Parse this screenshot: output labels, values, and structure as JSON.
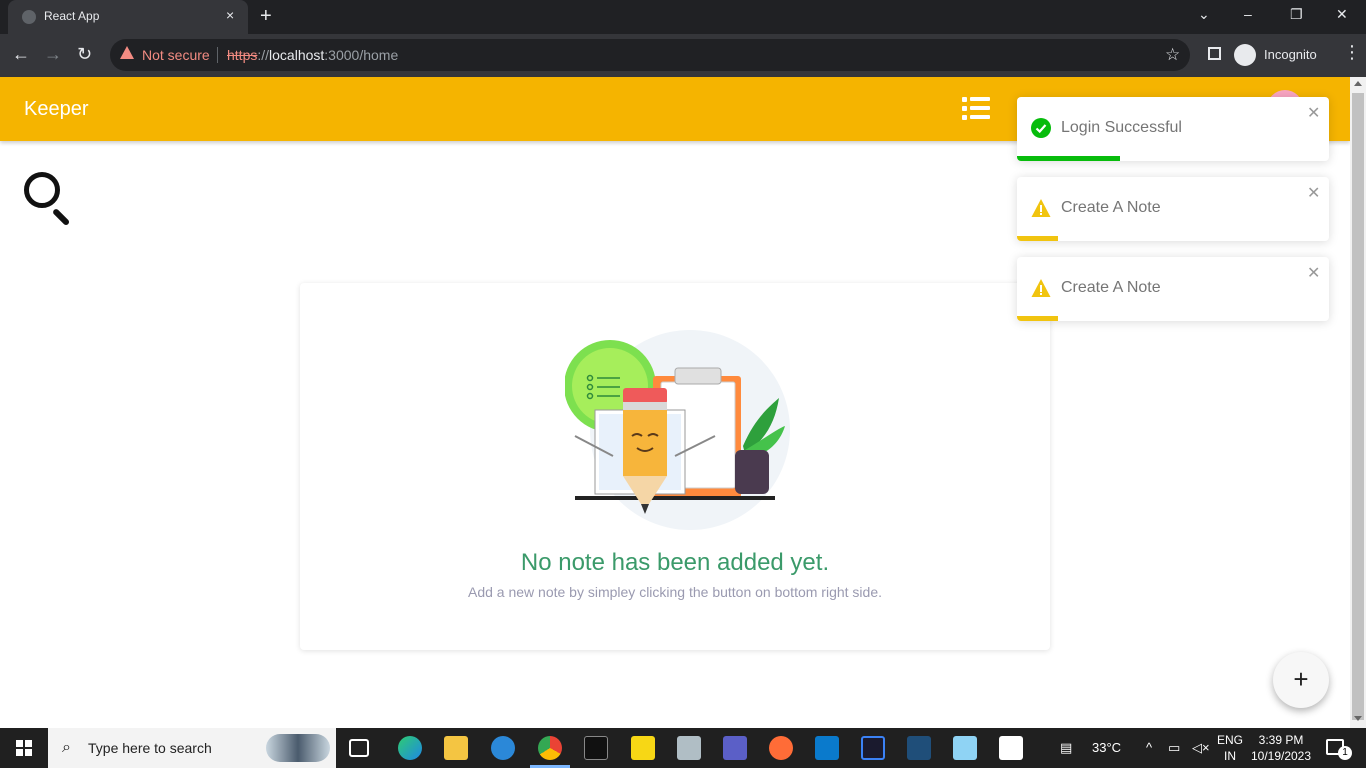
{
  "browser": {
    "tab_title": "React App",
    "tab_close": "×",
    "new_tab": "+",
    "security_label": "Not secure",
    "url_scheme": "https",
    "url_scheme_sep": "://",
    "url_host": "localhost",
    "url_path": ":3000/home",
    "incognito_label": "Incognito"
  },
  "app": {
    "brand": "Keeper",
    "empty_state": {
      "title": "No note has been added yet.",
      "subtitle": "Add a new note by simpley clicking the button on bottom right side."
    },
    "fab_label": "+"
  },
  "toasts": [
    {
      "message": "Login Successful",
      "type": "success",
      "color": "#07bc0c",
      "progress": 0.33
    },
    {
      "message": "Create A Note",
      "type": "warning",
      "color": "#f1c40f",
      "progress": 0.13
    },
    {
      "message": "Create A Note",
      "type": "warning",
      "color": "#f1c40f",
      "progress": 0.13
    }
  ],
  "taskbar": {
    "search_placeholder": "Type here to search",
    "weather": "33°C",
    "lang_line1": "ENG",
    "lang_line2": "IN",
    "time": "3:39 PM",
    "date": "10/19/2023",
    "notification_count": "1"
  },
  "colors": {
    "appbar": "#f5b400",
    "empty_title": "#3b9a6a"
  }
}
